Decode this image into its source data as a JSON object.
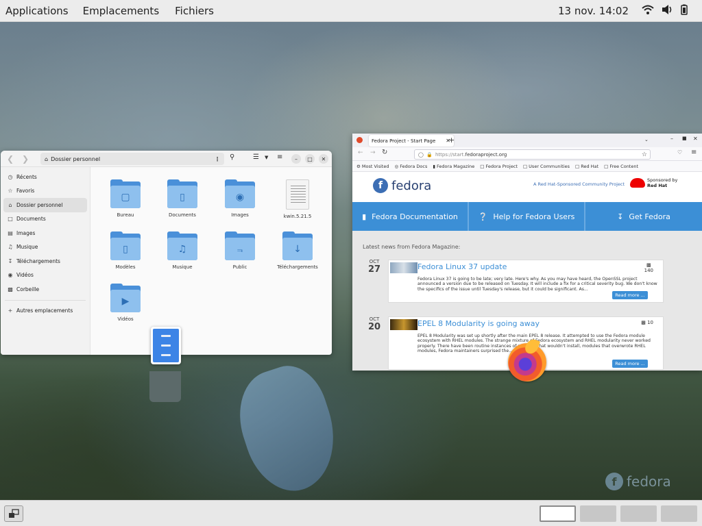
{
  "topbar": {
    "applications": "Applications",
    "places": "Emplacements",
    "files_app": "Fichiers",
    "clock": "13 nov.  14:02"
  },
  "files_window": {
    "path": "Dossier personnel",
    "sidebar": [
      {
        "label": "Récents",
        "icon": "clock-icon"
      },
      {
        "label": "Favoris",
        "icon": "star-icon"
      },
      {
        "label": "Dossier personnel",
        "icon": "home-icon",
        "active": true
      },
      {
        "label": "Documents",
        "icon": "document-icon"
      },
      {
        "label": "Images",
        "icon": "image-icon"
      },
      {
        "label": "Musique",
        "icon": "music-icon"
      },
      {
        "label": "Téléchargements",
        "icon": "download-icon"
      },
      {
        "label": "Vidéos",
        "icon": "video-icon"
      },
      {
        "label": "Corbeille",
        "icon": "trash-icon"
      }
    ],
    "other_locations": "Autres emplacements",
    "items": [
      {
        "label": "Bureau",
        "icon": "desktop-folder-icon"
      },
      {
        "label": "Documents",
        "icon": "documents-folder-icon"
      },
      {
        "label": "Images",
        "icon": "camera-folder-icon"
      },
      {
        "label": "kwin.5.21.5",
        "icon": "text-file-icon"
      },
      {
        "label": "Modèles",
        "icon": "templates-folder-icon"
      },
      {
        "label": "Musique",
        "icon": "music-folder-icon"
      },
      {
        "label": "Public",
        "icon": "share-folder-icon"
      },
      {
        "label": "Téléchargements",
        "icon": "download-folder-icon"
      },
      {
        "label": "Vidéos",
        "icon": "video-folder-icon"
      }
    ]
  },
  "firefox": {
    "tab_title": "Fedora Project - Start Page",
    "url_prefix": "https://start.",
    "url_domain": "fedoraproject.org",
    "bookmarks": [
      "Most Visited",
      "Fedora Docs",
      "Fedora Magazine",
      "Fedora Project",
      "User Communities",
      "Red Hat",
      "Free Content"
    ],
    "page": {
      "logo": "fedora",
      "sponsor_text": "A Red Hat-Sponsored Community Project",
      "sponsored_by": "Sponsored by",
      "red_hat": "Red Hat",
      "nav": [
        "Fedora Documentation",
        "Help for Fedora Users",
        "Get Fedora"
      ],
      "news_heading": "Latest news from Fedora Magazine:",
      "articles": [
        {
          "month": "OCT",
          "day": "27",
          "title": "Fedora Linux 37 update",
          "comments": "140",
          "body": "Fedora Linux 37 is going to be late; very late. Here's why. As you may have heard, the OpenSSL project announced a version due to be released on Tuesday. It will include a fix for a critical severity bug. We don't know the specifics of the issue until Tuesday's release, but it could be significant. As...",
          "more": "Read more ..."
        },
        {
          "month": "OCT",
          "day": "20",
          "title": "EPEL 8 Modularity is going away",
          "comments": "10",
          "body": "EPEL 8 Modularity was set up shortly after the main EPEL 8 release. It attempted to use the Fedora module ecosystem with RHEL modules. The strange mixture of Fedora ecosystem and RHEL modularity never worked properly. There have been routine instances of modules that wouldn't install, modules that overwrote RHEL modules, Fedora maintainers surprised the...",
          "more": "Read more ..."
        }
      ]
    }
  },
  "watermark": "fedora",
  "colors": {
    "accent": "#3c8fd6",
    "folder": "#4a90d9",
    "fedora_blue": "#294172"
  }
}
